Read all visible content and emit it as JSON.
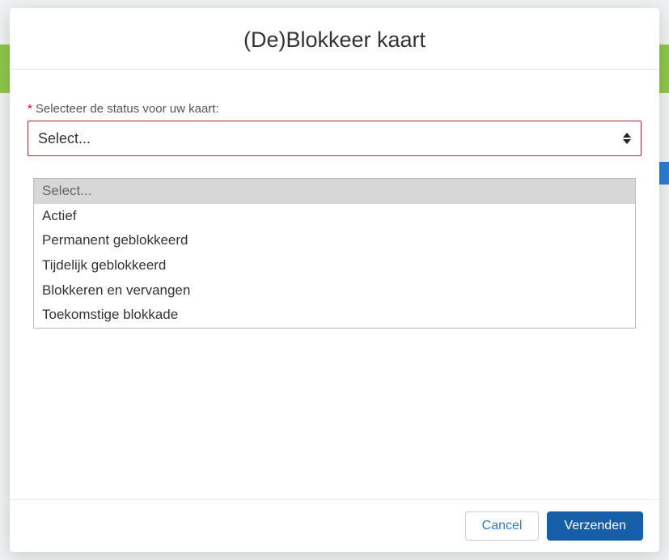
{
  "modal": {
    "title": "(De)Blokkeer kaart",
    "field": {
      "required_marker": "*",
      "label": "Selecteer de status voor uw kaart:",
      "selected": "Select..."
    },
    "options": [
      "Select...",
      "Actief",
      "Permanent geblokkeerd",
      "Tijdelijk geblokkeerd",
      "Blokkeren en vervangen",
      "Toekomstige blokkade"
    ],
    "footer": {
      "cancel": "Cancel",
      "submit": "Verzenden"
    }
  }
}
